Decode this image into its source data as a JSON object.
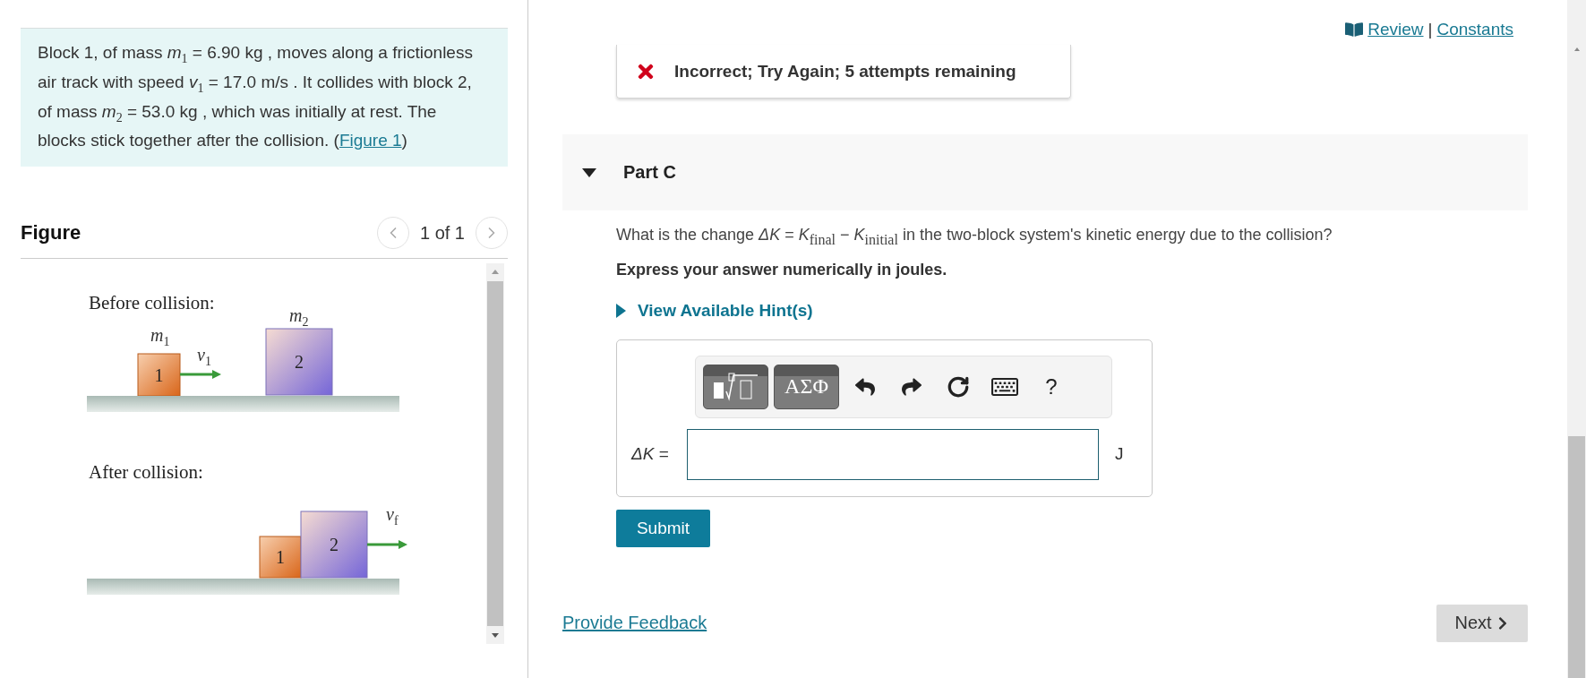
{
  "header": {
    "review_link": "Review",
    "separator": "|",
    "constants_link": "Constants"
  },
  "problem": {
    "text": "Block 1, of mass *m*$_{1}$ = 6.90 kg , moves along a frictionless air track with speed *v*$_{1}$ = 17.0 m/s . It collides with block 2, of mass *m*$_{2}$ = 53.0 kg , which was initially at rest. The blocks stick together after the collision. (",
    "figure_link": "Figure 1",
    "text_after": ")"
  },
  "figure": {
    "title": "Figure",
    "pager": "1 of 1",
    "before": {
      "caption": "Before collision:",
      "block_labels": [
        "1",
        "2"
      ],
      "mass_labels": [
        {
          "symbol": "m",
          "sub": "1"
        },
        {
          "symbol": "m",
          "sub": "2"
        }
      ],
      "velocity": {
        "symbol": "v",
        "sub": "1"
      }
    },
    "after": {
      "caption": "After collision:",
      "block_labels": [
        "1",
        "2"
      ],
      "velocity": {
        "symbol": "v",
        "sub": "f"
      }
    }
  },
  "feedback": {
    "kind": "incorrect",
    "message": "Incorrect; Try Again; 5 attempts remaining"
  },
  "part": {
    "label": "Part C",
    "expanded": true,
    "question": "What is the change *ΔK* = *K*$_{final}$ − *K*$_{initial}$ in the two-block system's kinetic energy due to the collision?",
    "instruction": "Express your answer numerically in joules.",
    "hint": {
      "label": "View Available Hint(s)",
      "expanded": false
    },
    "toolbar": [
      {
        "kind": "templates"
      },
      {
        "kind": "symbols",
        "label": "ΑΣΦ"
      },
      {
        "kind": "undo"
      },
      {
        "kind": "redo"
      },
      {
        "kind": "reset"
      },
      {
        "kind": "keyboard"
      },
      {
        "kind": "help",
        "label": "?"
      }
    ],
    "answer": {
      "label": "*ΔK* =",
      "unit": "J"
    },
    "submit": "Submit"
  },
  "footer": {
    "feedback_link": "Provide Feedback",
    "next": "Next"
  }
}
